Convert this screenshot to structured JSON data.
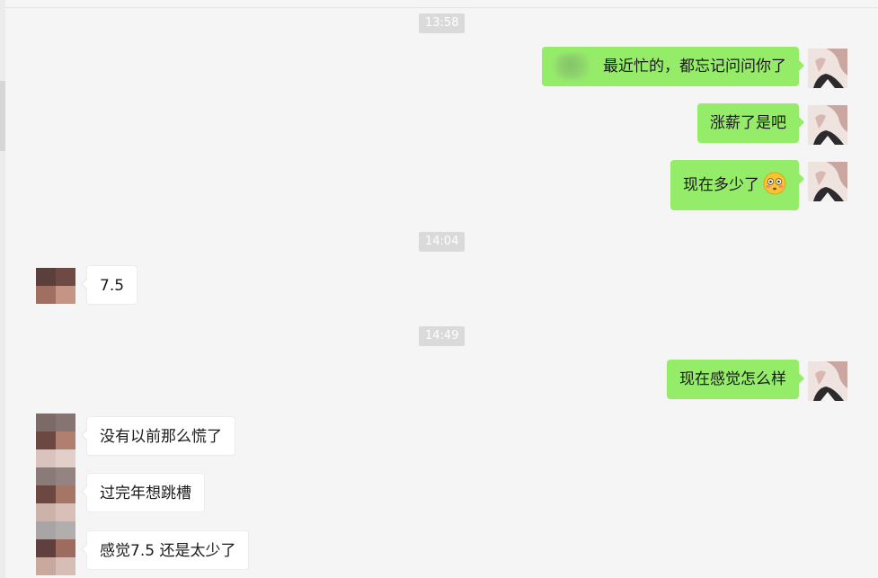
{
  "colors": {
    "background": "#f5f5f5",
    "my_bubble": "#95ec69",
    "their_bubble": "#ffffff",
    "timestamp_bg": "#dadada"
  },
  "timestamps": [
    "13:58",
    "14:04",
    "14:49"
  ],
  "messages": [
    {
      "from": "me",
      "text": "最近忙的，都忘记问问你了",
      "has_blurred_sticker": true
    },
    {
      "from": "me",
      "text": "涨薪了是吧"
    },
    {
      "from": "me",
      "text": "现在多少了",
      "emoji": "flushed-face-emoji"
    },
    {
      "from": "them",
      "text": "7.5"
    },
    {
      "from": "me",
      "text": "现在感觉怎么样"
    },
    {
      "from": "them",
      "text": "没有以前那么慌了"
    },
    {
      "from": "them",
      "text": "过完年想跳槽"
    },
    {
      "from": "them",
      "text": "感觉7.5 还是太少了"
    }
  ],
  "avatars": {
    "me": "user-avatar",
    "them": "contact-avatar-pixelated"
  }
}
